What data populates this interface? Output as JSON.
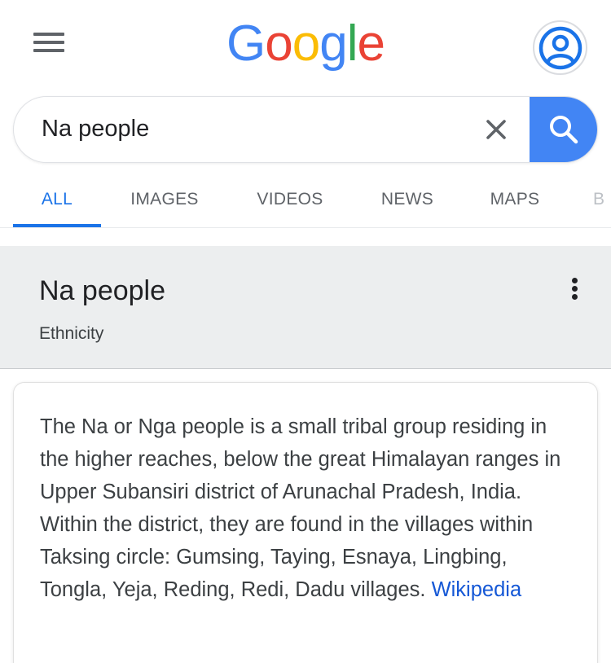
{
  "colors": {
    "accent": "#1a73e8",
    "search_button": "#4285f4",
    "link": "#1558d6",
    "panel_background": "#eceeef",
    "logo_blue": "#4285f4",
    "logo_red": "#ea4335",
    "logo_yellow": "#fbbc05",
    "logo_green": "#34a853"
  },
  "header": {
    "menu_icon": "hamburger-menu-icon",
    "logo_text": "Google",
    "avatar_icon": "account-circle-icon"
  },
  "search": {
    "value": "Na people",
    "clear_icon": "close-icon",
    "search_icon": "search-icon"
  },
  "tabs": [
    {
      "label": "ALL",
      "active": true
    },
    {
      "label": "IMAGES",
      "active": false
    },
    {
      "label": "VIDEOS",
      "active": false
    },
    {
      "label": "NEWS",
      "active": false
    },
    {
      "label": "MAPS",
      "active": false
    },
    {
      "label": "B",
      "active": false
    }
  ],
  "knowledge_panel": {
    "title": "Na people",
    "subtitle": "Ethnicity",
    "more_icon": "more-vert-icon",
    "description": "The Na or Nga people is a small tribal group residing in the higher reaches, below the great Himalayan ranges in Upper Subansiri district of Arunachal Pradesh, India. Within the district, they are found in the villages within Taksing circle: Gumsing, Taying, Esnaya, Lingbing, Tongla, Yeja, Reding, Redi, Dadu villages.",
    "source_link": "Wikipedia"
  }
}
